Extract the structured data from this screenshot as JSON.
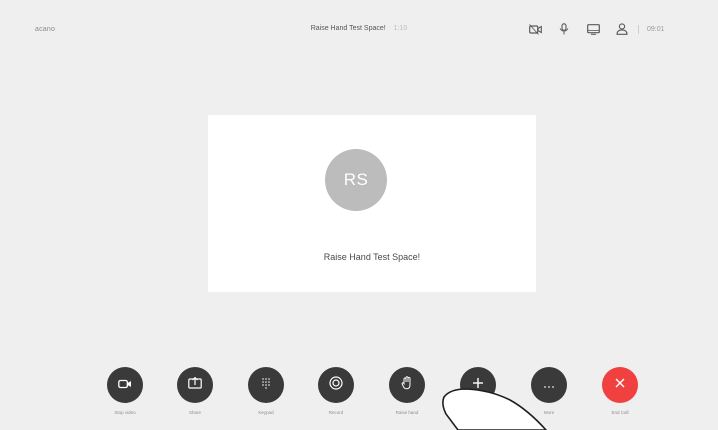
{
  "topbar": {
    "brand": "acano",
    "title": "Raise Hand Test Space!",
    "duration": "1:10",
    "clock": "09:01",
    "icons": [
      "camera-icon",
      "microphone-icon",
      "display-icon",
      "participants-icon"
    ]
  },
  "main": {
    "avatar_initials": "RS",
    "participant_name": "Raise Hand Test Space!"
  },
  "controls": [
    {
      "label": "Stop video",
      "icon": "video-icon"
    },
    {
      "label": "Share",
      "icon": "share-icon"
    },
    {
      "label": "Keypad",
      "icon": "keypad-icon"
    },
    {
      "label": "Record",
      "icon": "record-icon"
    },
    {
      "label": "Raise hand",
      "icon": "hand-icon"
    },
    {
      "label": "",
      "icon": "plus-icon"
    },
    {
      "label": "More",
      "icon": "more-icon"
    },
    {
      "label": "End Call",
      "icon": "close-icon"
    }
  ],
  "colors": {
    "background": "#efefef",
    "card": "#ffffff",
    "avatar": "#bcbcbc",
    "button": "#3a3a3a",
    "end_call": "#f04040"
  }
}
